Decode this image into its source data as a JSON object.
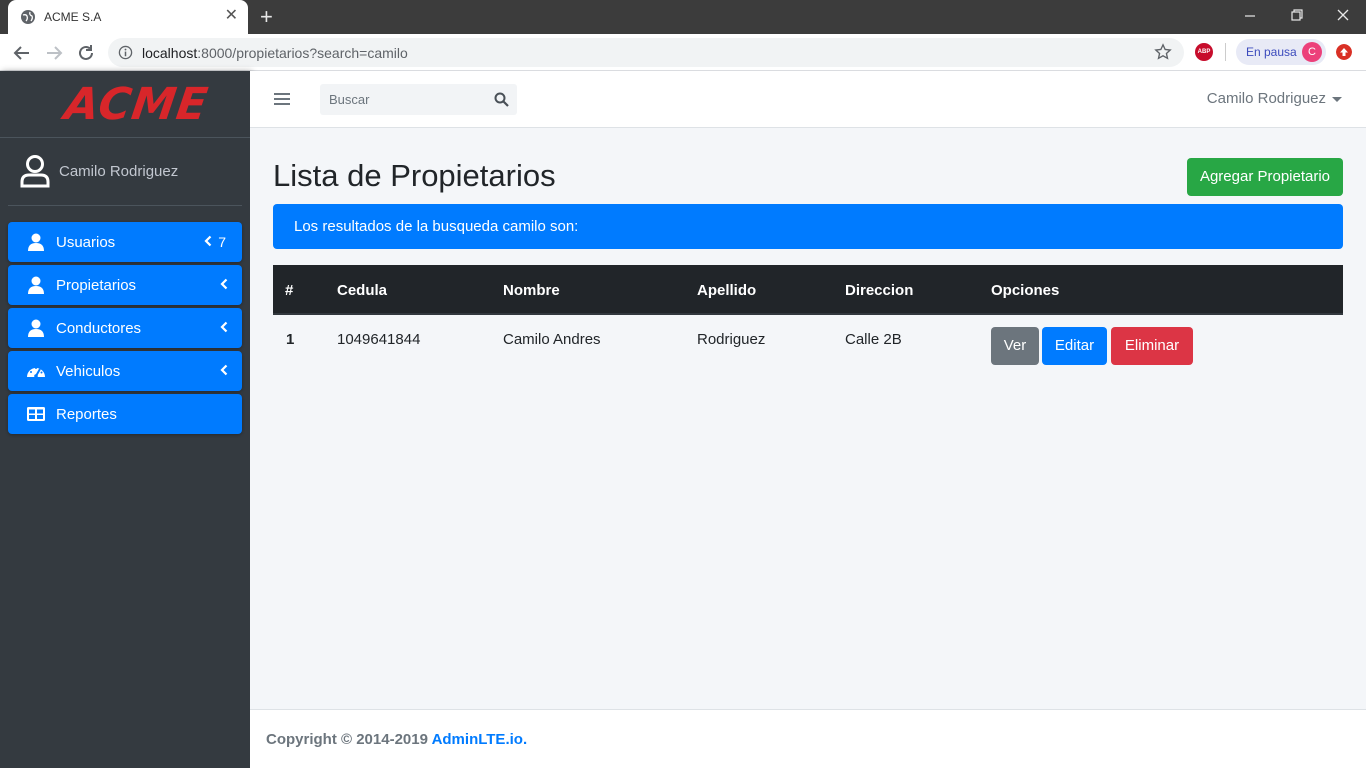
{
  "browser": {
    "tab_title": "ACME S.A",
    "tab_close": "✕",
    "new_tab": "+",
    "url_host": "localhost",
    "url_rest": ":8000/propietarios?search=camilo",
    "paused_label": "En pausa",
    "profile_initial": "C",
    "adblock_label": "ABP"
  },
  "sidebar": {
    "brand": "ACME",
    "user_name": "Camilo Rodriguez",
    "items": [
      {
        "label": "Usuarios",
        "icon": "user-icon",
        "badge": "7",
        "chevron": true
      },
      {
        "label": "Propietarios",
        "icon": "user-icon",
        "chevron": true
      },
      {
        "label": "Conductores",
        "icon": "user-icon",
        "chevron": true
      },
      {
        "label": "Vehiculos",
        "icon": "dashboard-gauge-icon",
        "chevron": true
      },
      {
        "label": "Reportes",
        "icon": "table-icon",
        "chevron": false
      }
    ]
  },
  "navbar": {
    "search_placeholder": "Buscar",
    "user_name": "Camilo Rodriguez"
  },
  "main": {
    "title": "Lista de Propietarios",
    "add_button": "Agregar Propietario",
    "alert": "Los resultados de la busqueda camilo son:",
    "table": {
      "headers": [
        "#",
        "Cedula",
        "Nombre",
        "Apellido",
        "Direccion",
        "Opciones"
      ],
      "rows": [
        {
          "num": "1",
          "cedula": "1049641844",
          "nombre": "Camilo Andres",
          "apellido": "Rodriguez",
          "direccion": "Calle 2B"
        }
      ],
      "actions": {
        "view": "Ver",
        "edit": "Editar",
        "delete": "Eliminar"
      }
    }
  },
  "footer": {
    "text": "Copyright © 2014-2019 ",
    "link": "AdminLTE.io."
  },
  "colors": {
    "sidebar_bg": "#343a40",
    "primary": "#007bff",
    "success": "#28a745",
    "danger": "#dc3545",
    "secondary": "#6c757d",
    "brand_red": "#d8262a"
  }
}
